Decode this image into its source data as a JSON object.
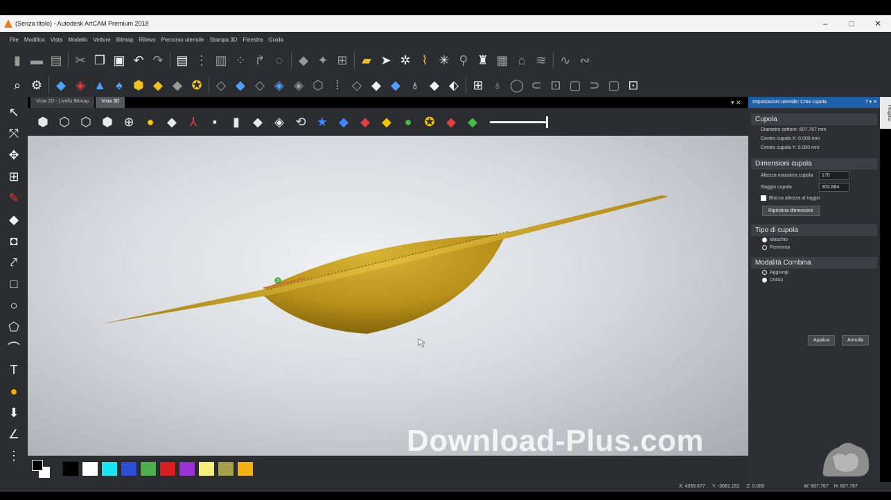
{
  "window": {
    "title": "(Senza titolo) - Autodesk ArtCAM Premium 2018",
    "controls": [
      "–",
      "□",
      "✕"
    ]
  },
  "menu": [
    "File",
    "Modifica",
    "Vista",
    "Modello",
    "Vettore",
    "Bitmap",
    "Rilievo",
    "Percorso utensile",
    "Stampa 3D",
    "Finestra",
    "Guida"
  ],
  "tabs": [
    "Vista 2D - Livello Bitmap",
    "Vista 3D"
  ],
  "active_tab": "Vista 3D",
  "panel": {
    "title": "Impostazioni utensile: Crea cupola",
    "title_controls": "? ▾ ✕",
    "side_tab": "Progetto",
    "sections": {
      "cupola": {
        "heading": "Cupola",
        "lines": [
          "Diametro settore: 607.767 mm",
          "Centro cupola X: 0.000 mm",
          "Centro cupola Y: 0.000 mm"
        ]
      },
      "dimensioni": {
        "heading": "Dimensioni cupola",
        "height_label": "Altezza massima cupola",
        "height_value": "170",
        "radius_label": "Raggio cupola",
        "radius_value": "303.884",
        "lock_label": "Blocca altezza al raggio",
        "reset_button": "Ripristina dimensioni"
      },
      "tipo": {
        "heading": "Tipo di cupola",
        "options": [
          "Maschio",
          "Femmina"
        ]
      },
      "combina": {
        "heading": "Modalità Combina",
        "options": [
          "Aggiungi",
          "Unisci"
        ]
      }
    },
    "apply_button": "Applica",
    "cancel_button": "Annulla"
  },
  "status": {
    "x": "X: 4355.677",
    "y": "Y: -3081.152",
    "z": "Z: 0.000",
    "w": "W: 607.767",
    "h": "H: 607.767"
  },
  "watermark": "Download-Plus.com",
  "palette_colors": [
    "#000000",
    "#ffffff",
    "#19e5f0",
    "#2d4fd8",
    "#4cae4c",
    "#d81e1e",
    "#9a33d6",
    "#f6ee7a",
    "#a6a04a",
    "#f2b213"
  ],
  "colors": {
    "dome": "#c9a21e",
    "accent": "#1d5fa8",
    "background": "#2b2d30"
  }
}
